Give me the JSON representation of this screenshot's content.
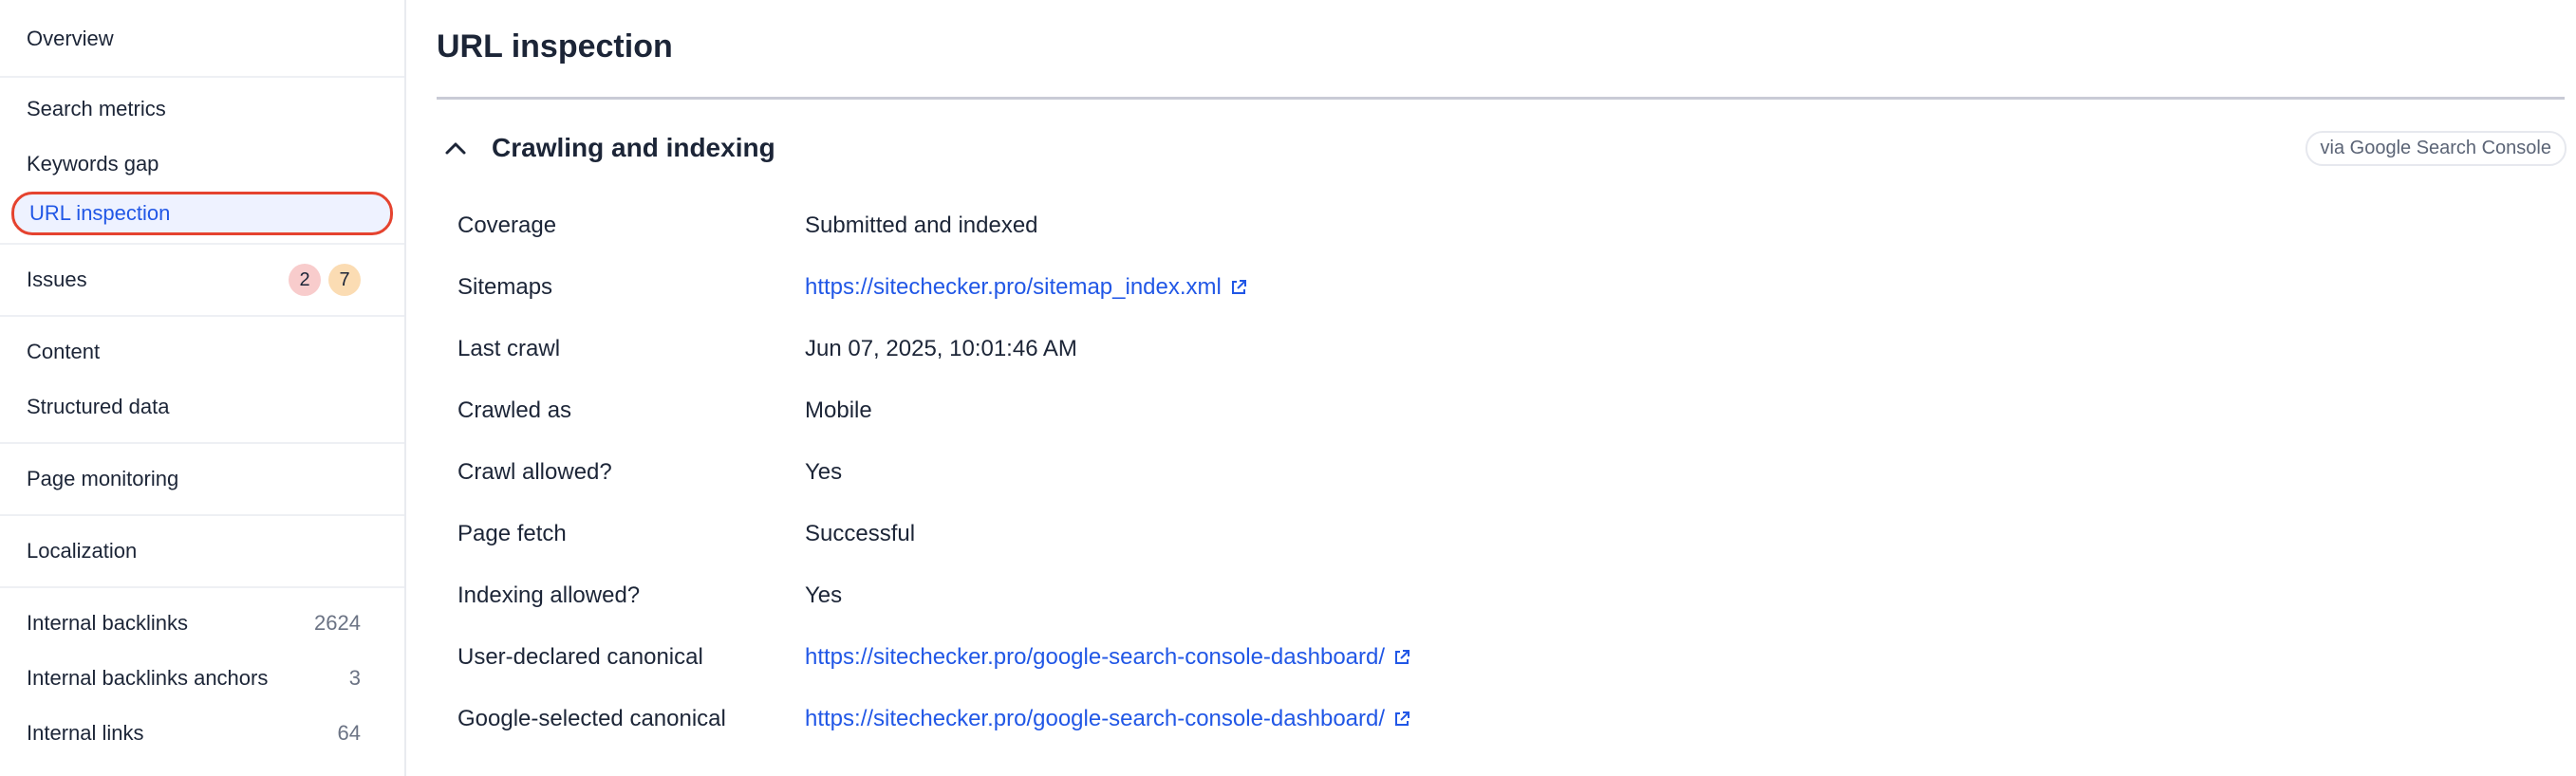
{
  "sidebar": {
    "groups": [
      {
        "items": [
          {
            "label": "Overview"
          }
        ]
      },
      {
        "items": [
          {
            "label": "Search metrics"
          },
          {
            "label": "Keywords gap"
          },
          {
            "label": "URL inspection"
          }
        ]
      },
      {
        "items": [
          {
            "label": "Issues",
            "badges": [
              "2",
              "7"
            ]
          }
        ]
      },
      {
        "items": [
          {
            "label": "Content"
          },
          {
            "label": "Structured data"
          }
        ]
      },
      {
        "items": [
          {
            "label": "Page monitoring"
          }
        ]
      },
      {
        "items": [
          {
            "label": "Localization"
          }
        ]
      },
      {
        "items": [
          {
            "label": "Internal backlinks",
            "count": "2624"
          },
          {
            "label": "Internal backlinks anchors",
            "count": "3"
          },
          {
            "label": "Internal links",
            "count": "64"
          }
        ]
      }
    ]
  },
  "main": {
    "title": "URL inspection",
    "section": {
      "title": "Crawling and indexing",
      "source": "via Google Search Console",
      "chevron_icon": "chevron-up-icon",
      "rows": [
        {
          "key": "Coverage",
          "value": "Submitted and indexed"
        },
        {
          "key": "Sitemaps",
          "value": "https://sitechecker.pro/sitemap_index.xml",
          "link": true
        },
        {
          "key": "Last crawl",
          "value": "Jun 07, 2025, 10:01:46 AM"
        },
        {
          "key": "Crawled as",
          "value": "Mobile"
        },
        {
          "key": "Crawl allowed?",
          "value": "Yes"
        },
        {
          "key": "Page fetch",
          "value": "Successful"
        },
        {
          "key": "Indexing allowed?",
          "value": "Yes"
        },
        {
          "key": "User-declared canonical",
          "value": "https://sitechecker.pro/google-search-console-dashboard/",
          "link": true
        },
        {
          "key": "Google-selected canonical",
          "value": "https://sitechecker.pro/google-search-console-dashboard/",
          "link": true
        }
      ]
    }
  },
  "colors": {
    "accent": "#2157e6",
    "active_outline": "#e5432f",
    "active_bg": "#eef2ff",
    "badge_red": "#f8cccc",
    "badge_orange": "#fbdcb3"
  }
}
